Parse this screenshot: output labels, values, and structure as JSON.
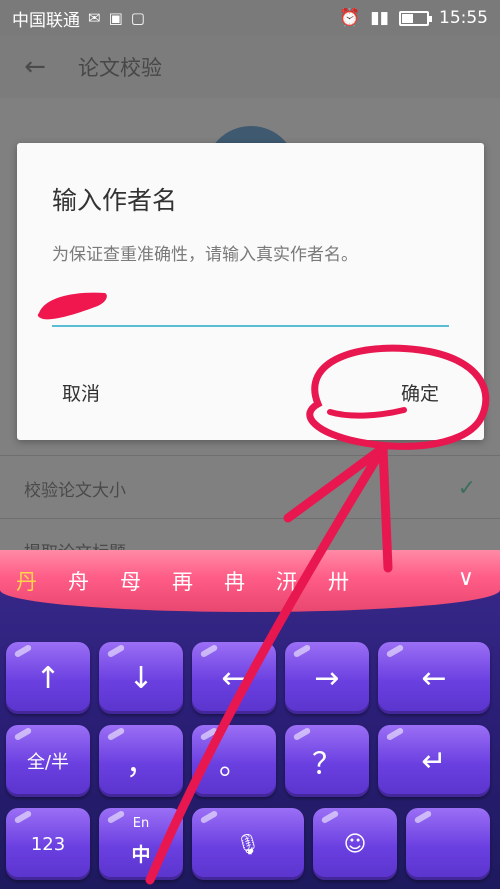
{
  "status_bar": {
    "carrier": "中国联通",
    "time": "15:55",
    "battery_level": 0.45
  },
  "app_bar": {
    "title": "论文校验"
  },
  "background_rows": [
    {
      "label": "校验论文大小"
    },
    {
      "label": "提取论文标题"
    }
  ],
  "dialog": {
    "title": "输入作者名",
    "message": "为保证查重准确性，请输入真实作者名。",
    "input_value": "",
    "cancel_label": "取消",
    "ok_label": "确定"
  },
  "keyboard": {
    "candidates": [
      "丹",
      "舟",
      "母",
      "再",
      "冉",
      "汧",
      "卅"
    ],
    "rows": [
      [
        "↑",
        "↓",
        "←",
        "→",
        "←"
      ],
      [
        "全/半",
        "，",
        "。",
        "？",
        "↵"
      ],
      [
        "123",
        "中",
        "",
        "",
        ""
      ]
    ],
    "lang_key": {
      "sub": "En",
      "main": "中"
    }
  },
  "colors": {
    "accent_line": "#5bbcd6",
    "annotation": "#e8174f",
    "candidate_bar": "#ff5c87",
    "key": "#6a3fe0"
  }
}
